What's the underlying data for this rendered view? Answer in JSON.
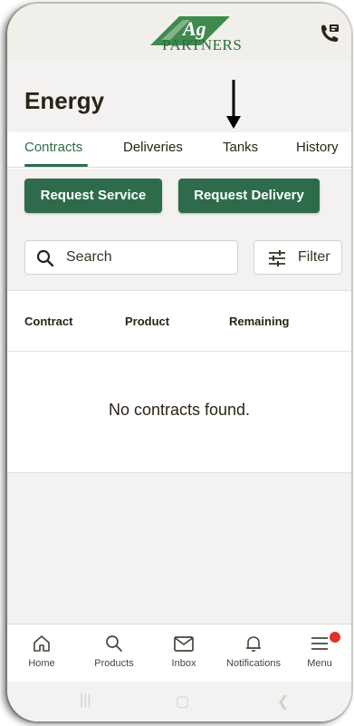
{
  "header": {
    "logo_text": "PARTNERS",
    "logo_mark": "Ag",
    "icons": {
      "logo": "ag-partners-logo",
      "contact": "phone-contact-icon"
    }
  },
  "page": {
    "title": "Energy"
  },
  "tabs": [
    {
      "label": "Contracts",
      "active": true
    },
    {
      "label": "Deliveries",
      "active": false
    },
    {
      "label": "Tanks",
      "active": false
    },
    {
      "label": "History",
      "active": false
    }
  ],
  "actions": {
    "request_service": "Request Service",
    "request_delivery": "Request Delivery"
  },
  "search": {
    "label": "Search",
    "icon": "search-icon"
  },
  "filter": {
    "label": "Filter",
    "icon": "filter-sliders-icon"
  },
  "table": {
    "columns": [
      "Contract",
      "Product",
      "Remaining"
    ],
    "empty_message": "No contracts found."
  },
  "bottom_nav": [
    {
      "label": "Home",
      "icon": "home-icon"
    },
    {
      "label": "Products",
      "icon": "search-icon"
    },
    {
      "label": "Inbox",
      "icon": "mail-icon"
    },
    {
      "label": "Notifications",
      "icon": "bell-icon"
    },
    {
      "label": "Menu",
      "icon": "menu-icon",
      "badge": true
    }
  ],
  "colors": {
    "brand_green": "#2e6b4a",
    "badge_red": "#e0332a",
    "text_dark": "#2b2416"
  }
}
